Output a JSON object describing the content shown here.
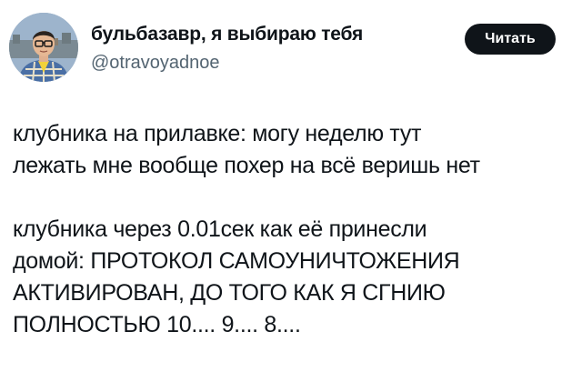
{
  "post": {
    "author_name": "бульбазавр, я выбираю тебя",
    "author_handle": "@otravoyadnoe",
    "follow_label": "Читать",
    "text": "клубника на прилавке: могу неделю тут\nлежать мне вообще похер на всё веришь нет\n\nклубника через 0.01сек как её принесли\nдомой: ПРОТОКОЛ САМОУНИЧТОЖЕНИЯ\nАКТИВИРОВАН, ДО ТОГО КАК Я СГНИЮ\nПОЛНОСТЬЮ 10.... 9.... 8...."
  },
  "colors": {
    "text_primary": "#0f1419",
    "text_secondary": "#536471",
    "button_bg": "#0f1419",
    "button_text": "#ffffff"
  },
  "icons": {
    "avatar": "profile-photo"
  }
}
